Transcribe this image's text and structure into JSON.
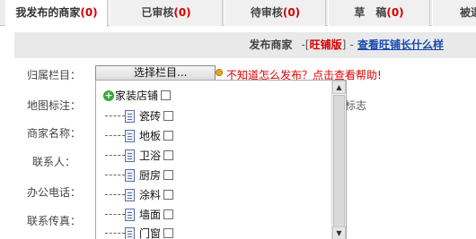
{
  "tabs": [
    {
      "label": "我发布的商家",
      "count": "(0)"
    },
    {
      "label": "已审核",
      "count": "(0)"
    },
    {
      "label": "待审核",
      "count": "(0)"
    },
    {
      "label": "草　稿",
      "count": "(0)"
    },
    {
      "label": "被退"
    }
  ],
  "header": {
    "title": "发布商家",
    "separator_open": "-[",
    "version": "旺铺版",
    "separator_close": "]",
    "dash": "-",
    "link": "查看旺铺长什么样"
  },
  "form": {
    "labels": {
      "category": "归属栏目：",
      "map": "地图标注：",
      "name": "商家名称：",
      "contact": "联系人：",
      "phone": "办公电话：",
      "fax": "联系传真："
    },
    "select_button": "选择栏目...",
    "help_text": "不知道怎么发布？点击查看帮助!",
    "map_note": "标志"
  },
  "tree": {
    "root": "家装店铺",
    "items": [
      "瓷砖",
      "地板",
      "卫浴",
      "厨房",
      "涂料",
      "墙面",
      "门窗"
    ]
  },
  "colors": {
    "accent_red": "#d40000",
    "link_blue": "#1a48b0",
    "help_red": "#e00000",
    "tab_bg": "#f0f0f0",
    "header_bg": "#e9e9e9"
  }
}
